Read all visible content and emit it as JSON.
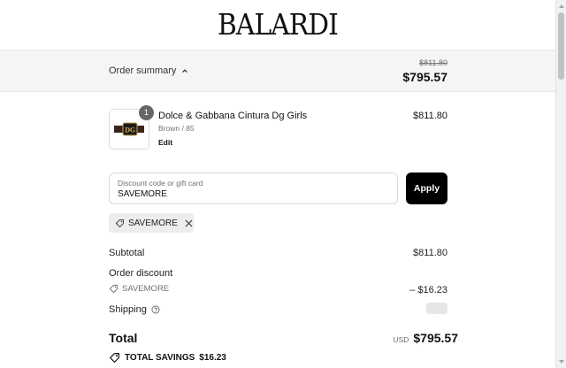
{
  "header": {
    "logo_text": "BALARDI"
  },
  "summary": {
    "toggle_label": "Order summary",
    "original_total": "$811.80",
    "total": "$795.57"
  },
  "cart": {
    "items": [
      {
        "quantity": "1",
        "name": "Dolce & Gabbana Cintura Dg Girls",
        "variant": "Brown / 85",
        "edit_label": "Edit",
        "price": "$811.80"
      }
    ]
  },
  "discount": {
    "placeholder": "Discount code or gift card",
    "value": "SAVEMORE",
    "apply_label": "Apply",
    "applied_code": "SAVEMORE"
  },
  "totals": {
    "subtotal_label": "Subtotal",
    "subtotal_value": "$811.80",
    "order_discount_label": "Order discount",
    "discount_code": "SAVEMORE",
    "discount_value": "– $16.23",
    "shipping_label": "Shipping",
    "total_label": "Total",
    "currency": "USD",
    "total_value": "$795.57",
    "savings_label": "TOTAL SAVINGS",
    "savings_value": "$16.23"
  },
  "icons": {
    "chevron": "chevron-up-icon",
    "tag": "tag-icon",
    "close": "close-icon",
    "help": "help-circle-icon"
  },
  "colors": {
    "accent": "#000000",
    "muted": "#707070",
    "panel": "#f5f5f5"
  }
}
